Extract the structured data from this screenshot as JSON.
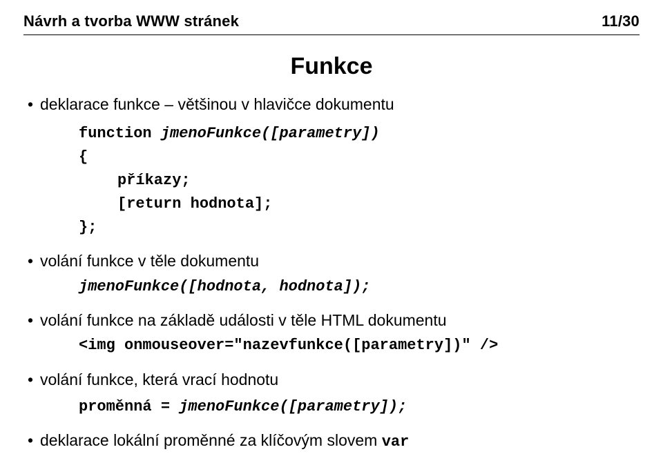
{
  "header": {
    "left": "Návrh a tvorba WWW stránek",
    "right": "11/30"
  },
  "title": "Funkce",
  "bullets": {
    "b1": {
      "text": "deklarace funkce – většinou v hlavičce dokumentu",
      "code": {
        "l1a": "function ",
        "l1b": "jmenoFunkce([parametry])",
        "l2": "{",
        "l3": "příkazy;",
        "l4": "[return hodnota];",
        "l5": "};"
      }
    },
    "b2": {
      "text": "volání funkce v těle dokumentu",
      "code": {
        "l1": "jmenoFunkce([hodnota, hodnota]);"
      }
    },
    "b3": {
      "text": "volání funkce na základě události v těle HTML dokumentu",
      "code": {
        "l1": "<img onmouseover=\"nazevfunkce([parametry])\" />"
      }
    },
    "b4": {
      "text": "volání funkce, která vrací hodnotu",
      "code": {
        "l1a": "proměnná = ",
        "l1b": "jmenoFunkce([parametry]);"
      }
    },
    "b5": {
      "text_a": "deklarace lokální proměnné za klíčovým slovem ",
      "text_b": "var"
    }
  }
}
